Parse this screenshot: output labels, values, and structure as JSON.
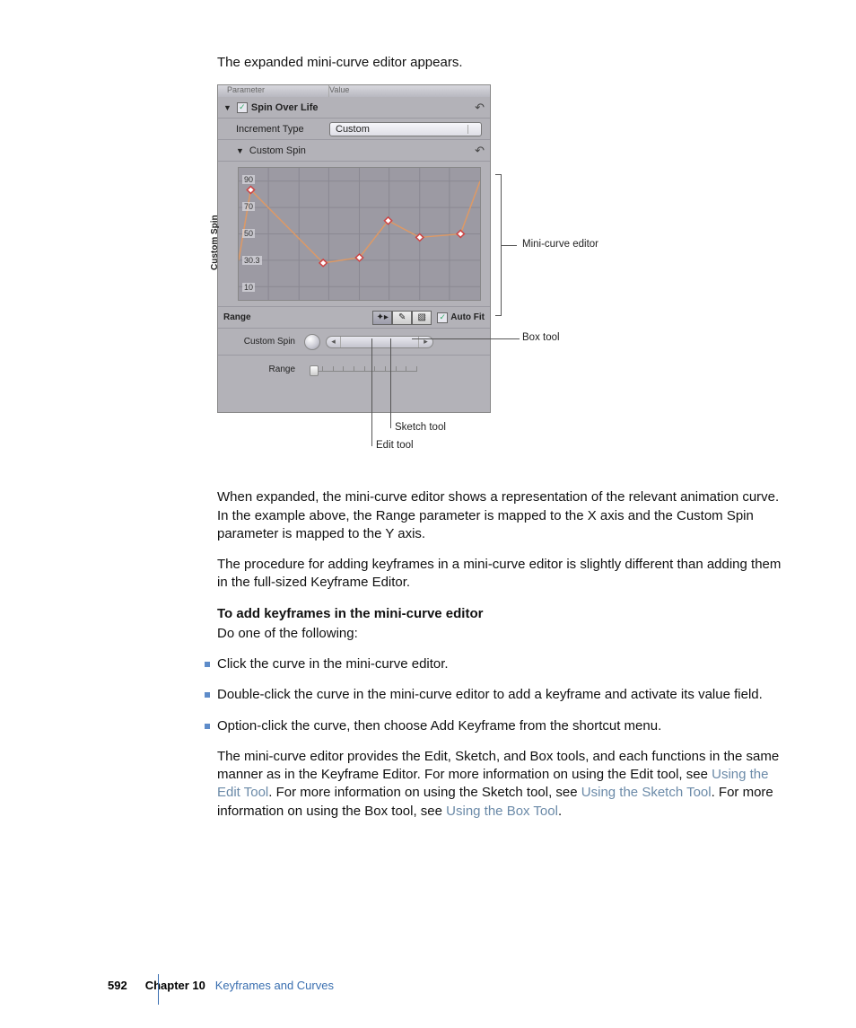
{
  "intro": "The expanded mini-curve editor appears.",
  "panel": {
    "header": {
      "parameter": "Parameter",
      "value": "Value"
    },
    "spin_over_life": "Spin Over Life",
    "increment_type": "Increment Type",
    "custom": "Custom",
    "custom_spin": "Custom Spin",
    "range": "Range",
    "auto_fit": "Auto Fit",
    "custom_spin_row": "Custom Spin",
    "range_row": "Range"
  },
  "callouts": {
    "mini": "Mini-curve editor",
    "box": "Box tool",
    "sketch": "Sketch tool",
    "edit": "Edit tool"
  },
  "body": {
    "p1": "When expanded, the mini-curve editor shows a representation of the relevant animation curve. In the example above, the Range parameter is mapped to the X axis and the Custom Spin parameter is mapped to the Y axis.",
    "p2": "The procedure for adding keyframes in a mini-curve editor is slightly different than adding them in the full-sized Keyframe Editor.",
    "h": "To add keyframes in the mini-curve editor",
    "sub": "Do one of the following:",
    "b1": "Click the curve in the mini-curve editor.",
    "b2": "Double-click the curve in the mini-curve editor to add a keyframe and activate its value field.",
    "b3": "Option-click the curve, then choose Add Keyframe from the shortcut menu.",
    "p3a": "The mini-curve editor provides the Edit, Sketch, and Box tools, and each functions in the same manner as in the Keyframe Editor. For more information on using the Edit tool, see ",
    "l1": "Using the Edit Tool",
    "p3b": ". For more information on using the Sketch tool, see ",
    "l2": "Using the Sketch Tool",
    "p3c": ". For more information on using the Box tool, see ",
    "l3": "Using the Box Tool",
    "p3d": "."
  },
  "footer": {
    "page": "592",
    "chapter": "Chapter 10",
    "title": "Keyframes and Curves"
  },
  "chart_data": {
    "type": "line",
    "title": "Custom Spin",
    "xlabel": "Range",
    "ylabel": "Custom Spin",
    "x": [
      0,
      5,
      35,
      50,
      62,
      75,
      92,
      100
    ],
    "values": [
      30,
      83,
      28,
      32,
      60,
      47,
      50,
      90
    ],
    "ylim": [
      0,
      100
    ],
    "yticks": [
      10.0,
      30.3,
      50.0,
      70.0,
      90.0
    ]
  }
}
